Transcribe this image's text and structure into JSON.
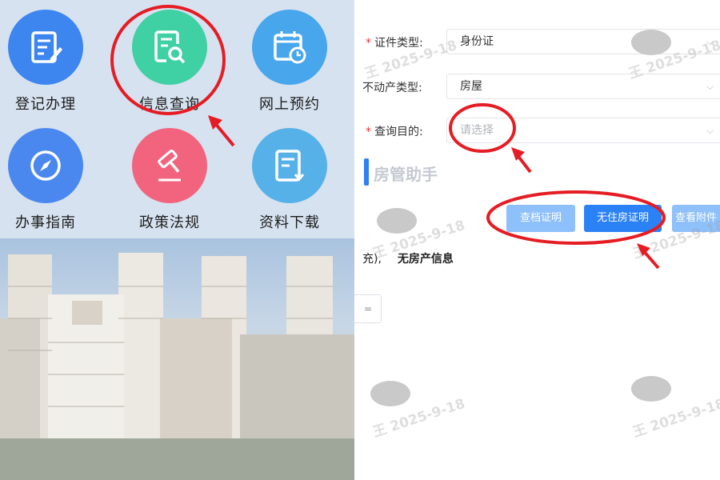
{
  "menu": {
    "items": [
      {
        "label": "登记办理",
        "icon": "edit-document-icon",
        "color": "#3d86f0"
      },
      {
        "label": "信息查询",
        "icon": "search-document-icon",
        "color": "#3fd0a3"
      },
      {
        "label": "网上预约",
        "icon": "calendar-clock-icon",
        "color": "#47a6ec"
      },
      {
        "label": "办事指南",
        "icon": "compass-icon",
        "color": "#4a88f0"
      },
      {
        "label": "政策法规",
        "icon": "gavel-icon",
        "color": "#f2647e"
      },
      {
        "label": "资料下载",
        "icon": "download-document-icon",
        "color": "#56b1e8"
      }
    ]
  },
  "form": {
    "id_type": {
      "label": "证件类型:",
      "value": "身份证"
    },
    "property_type": {
      "label": "不动产类型:",
      "value": "房屋"
    },
    "purpose": {
      "label": "查询目的:",
      "placeholder": "请选择"
    }
  },
  "section": {
    "title": "房管助手"
  },
  "buttons": {
    "archive": "查档证明",
    "no_house": "无住房证明",
    "attachment": "查看附件"
  },
  "result": {
    "prefix": "充),",
    "text": "无房产信息"
  },
  "small_box": "=",
  "watermark": {
    "name": "王",
    "date": "2025-9-18"
  },
  "colors": {
    "accent": "#2f7ff5",
    "annotation": "#e51c23"
  }
}
